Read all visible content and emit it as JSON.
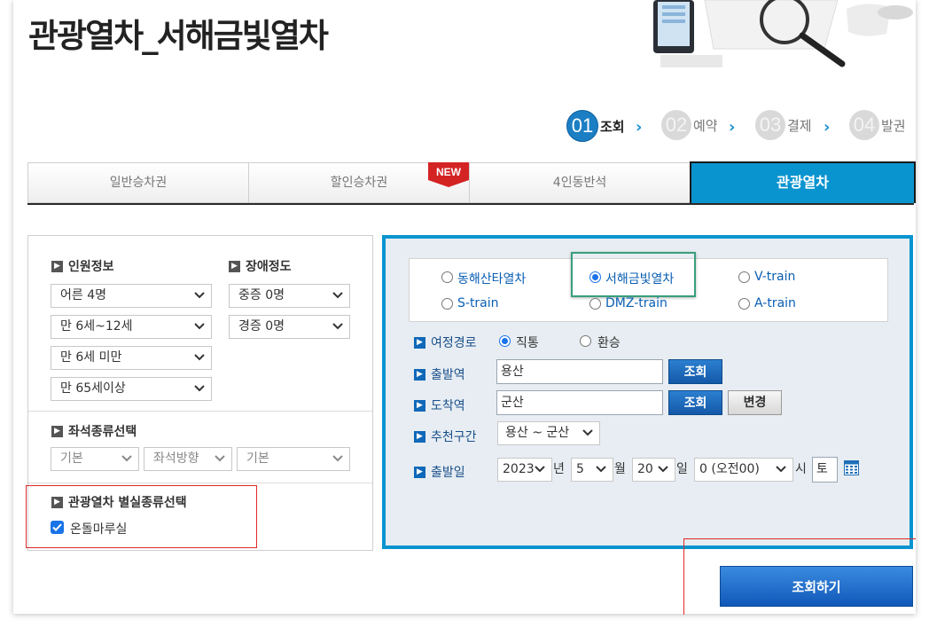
{
  "page": {
    "title": "관광열차_서해금빛열차"
  },
  "steps": [
    {
      "num": "01",
      "label": "조회",
      "active": true
    },
    {
      "num": "02",
      "label": "예약",
      "active": false
    },
    {
      "num": "03",
      "label": "결제",
      "active": false
    },
    {
      "num": "04",
      "label": "발권",
      "active": false
    }
  ],
  "tabs": [
    {
      "label": "일반승차권"
    },
    {
      "label": "할인승차권",
      "badge": "NEW"
    },
    {
      "label": "4인동반석"
    },
    {
      "label": "관광열차",
      "active": true
    }
  ],
  "left": {
    "people_heading": "인원정보",
    "disability_heading": "장애정도",
    "people": [
      "어른 4명",
      "만 6세~12세",
      "만 6세 미만",
      "만 65세이상"
    ],
    "disability": [
      "중증 0명",
      "경증 0명"
    ],
    "seat_heading": "좌석종류선택",
    "seat_selects": [
      "기본",
      "좌석방향",
      "기본"
    ],
    "room_heading": "관광열차 별실종류선택",
    "room_checkbox": "온돌마루실"
  },
  "trains": [
    "동해산타열차",
    "서해금빛열차",
    "V-train",
    "S-train",
    "DMZ-train",
    "A-train"
  ],
  "right": {
    "route_label": "여정경로",
    "route_direct": "직통",
    "route_transfer": "환승",
    "dep_label": "출발역",
    "dep_value": "용산",
    "arr_label": "도착역",
    "arr_value": "군산",
    "lookup_btn": "조회",
    "change_btn": "변경",
    "rec_label": "추천구간",
    "rec_value": "용산 ~ 군산",
    "date_label": "출발일",
    "year": "2023",
    "year_unit": "년",
    "month": "5",
    "month_unit": "월",
    "day": "20",
    "day_unit": "일",
    "hour": "0 (오전00)",
    "hour_unit": "시",
    "weekday": "토"
  },
  "search_button": "조회하기",
  "colors": {
    "accent": "#0a94cf",
    "button_blue": "#1459a8",
    "annotation_red": "#e02a2a"
  }
}
